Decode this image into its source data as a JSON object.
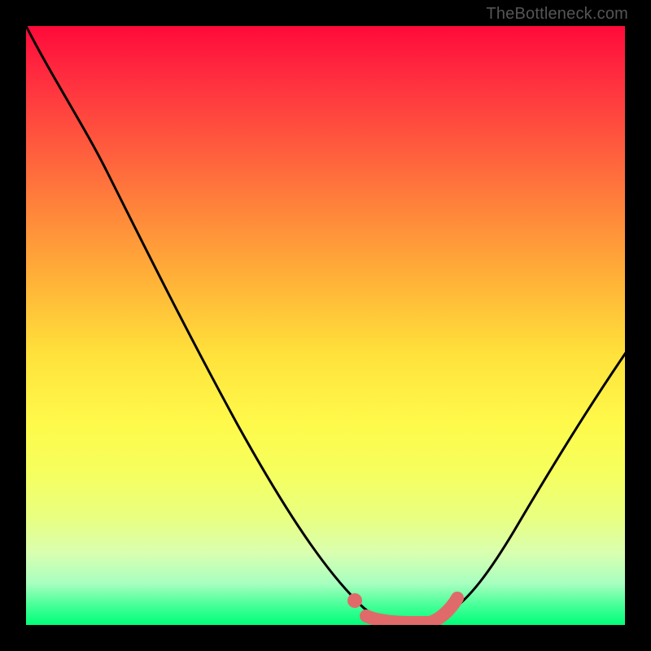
{
  "attribution": "TheBottleneck.com",
  "colors": {
    "gradient_top": "#ff0a3a",
    "gradient_mid": "#ffe23b",
    "gradient_bottom": "#00ff7a",
    "curve": "#000000",
    "highlight": "#e06a6a",
    "background": "#000000"
  },
  "chart_data": {
    "type": "line",
    "title": "",
    "xlabel": "",
    "ylabel": "",
    "xlim": [
      0,
      100
    ],
    "ylim": [
      0,
      100
    ],
    "grid": false,
    "legend": false,
    "series": [
      {
        "name": "curve",
        "x": [
          0,
          5,
          10,
          15,
          20,
          25,
          30,
          35,
          40,
          45,
          50,
          55,
          58,
          60,
          63,
          65,
          70,
          75,
          80,
          85,
          90,
          95,
          100
        ],
        "values": [
          100,
          94,
          86,
          78,
          70,
          62,
          54,
          45,
          36,
          27,
          18,
          10,
          5,
          3,
          1,
          0.5,
          0.5,
          2,
          8,
          18,
          30,
          42,
          55
        ]
      }
    ],
    "highlight_x_range": [
      56,
      70
    ],
    "highlight_marker_x": 56
  }
}
